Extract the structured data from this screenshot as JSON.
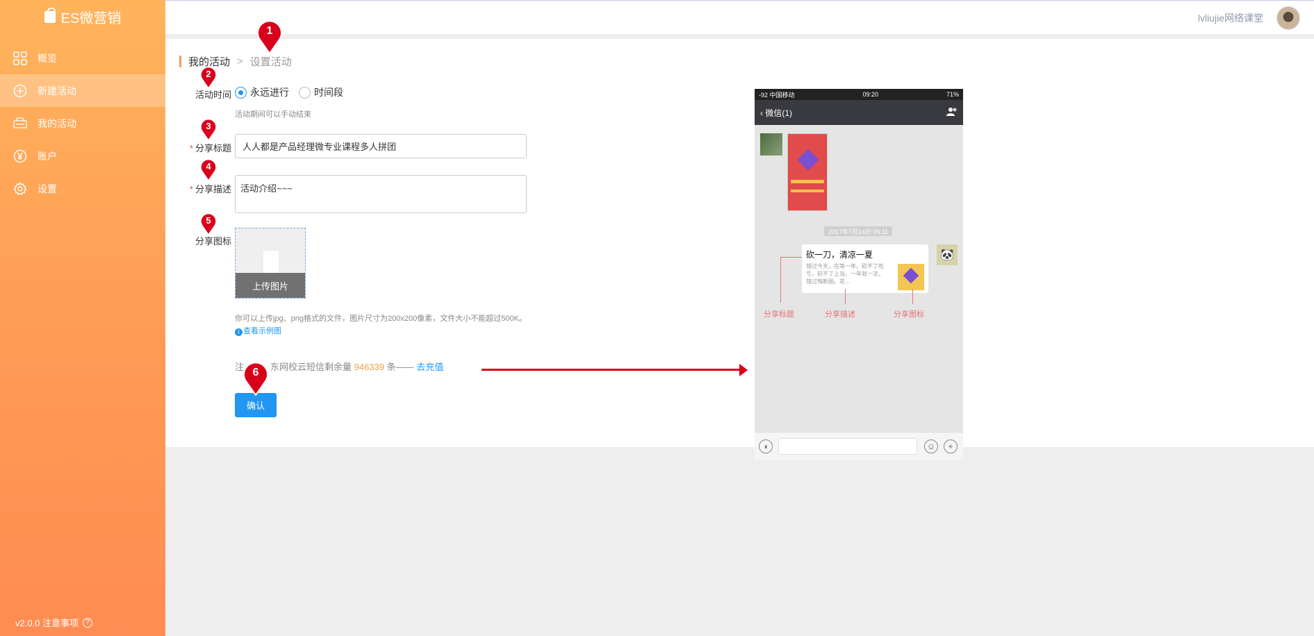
{
  "brand": {
    "name": "ES微营销"
  },
  "sidebar": {
    "items": [
      {
        "label": "概览",
        "icon": "grid-icon",
        "active": false
      },
      {
        "label": "新建活动",
        "icon": "plus-circle-icon",
        "active": true
      },
      {
        "label": "我的活动",
        "icon": "sale-tag-icon",
        "active": false
      },
      {
        "label": "账户",
        "icon": "yen-circle-icon",
        "active": false
      },
      {
        "label": "设置",
        "icon": "gear-icon",
        "active": false
      }
    ],
    "footer": "v2.0.0 注意事项",
    "help_glyph": "?"
  },
  "topbar": {
    "user_name": "lvliujie网络课堂"
  },
  "breadcrumb": {
    "parent": "我的活动",
    "separator": ">",
    "current": "设置活动"
  },
  "form": {
    "time_label": "活动时间",
    "radio_forever": "永远进行",
    "radio_period": "时间段",
    "time_hint": "活动期间可以手动结束",
    "title_label": "分享标题",
    "title_value": "人人都是产品经理微专业课程多人拼团",
    "desc_label": "分享描述",
    "desc_value": "活动介绍~~~",
    "icon_label": "分享图标",
    "upload_label": "上传图片",
    "upload_note": "你可以上传jpg、png格式的文件，图片尺寸为200x200像素，文件大小不能超过500K。",
    "example_link": "查看示例图",
    "sms_prefix": "注",
    "sms_middle": "东网校云短信剩余量",
    "sms_count": "946339",
    "sms_suffix": "条——",
    "sms_link": "去充值",
    "confirm": "确认"
  },
  "phone": {
    "status_left": "-92 中国移动",
    "status_time": "09:20",
    "status_right": "71%",
    "back_title": "微信(1)",
    "timestamp": "2017年7月14日 09:11",
    "card_title": "砍一刀，清凉一夏",
    "card_desc": "错过今天，在等一年。砍不了吃亏，砍不了上当。一年就一次，错过悔断肠。花...",
    "label_title": "分享标题",
    "label_desc": "分享描述",
    "label_icon": "分享图标"
  },
  "markers": [
    "1",
    "2",
    "3",
    "4",
    "5",
    "6"
  ],
  "colors": {
    "accent": "#2196f3",
    "sidebar": "#ff9a55",
    "marker": "#d9001b"
  }
}
